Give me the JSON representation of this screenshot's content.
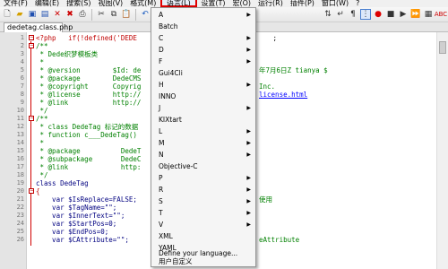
{
  "menubar": {
    "items": [
      "文件(F)",
      "编辑(E)",
      "搜索(S)",
      "视图(V)",
      "格式(M)",
      "语言(L)",
      "设置(T)",
      "宏(O)",
      "运行(R)",
      "插件(P)",
      "窗口(W)",
      "?"
    ]
  },
  "tab": {
    "label": "dedetag.class.php"
  },
  "toolbar_icons": [
    "new-file-icon",
    "open-icon",
    "save-icon",
    "save-all-icon",
    "close-icon",
    "close-all-icon",
    "print-icon",
    "cut-icon",
    "copy-icon",
    "paste-icon",
    "undo-icon",
    "redo-icon",
    "find-icon",
    "replace-icon",
    "zoom-in-icon",
    "zoom-out-icon",
    "sync-icon",
    "wrap-icon",
    "show-all-chars-icon",
    "indent-guide-icon",
    "record-macro-icon",
    "stop-record-icon",
    "play-macro-icon",
    "run-macro-multiple-icon",
    "save-macro-icon",
    "spellcheck-icon"
  ],
  "line_numbers": [
    "1",
    "2",
    "3",
    "4",
    "5",
    "6",
    "7",
    "8",
    "9",
    "10",
    "11",
    "12",
    "13",
    "14",
    "15",
    "16",
    "17",
    "18",
    "19",
    "20",
    "21",
    "22",
    "23",
    "24",
    "25",
    "26"
  ],
  "code": {
    "l1": "<?php   if(!defined('DEDE",
    "l1b": "   ;",
    "l2": "/**",
    "l3": " * Dede织梦模板类",
    "l4": " *",
    "l5": " * @version        $Id: de",
    "l5b": "年7月6日Z tianya $",
    "l6": " * @package        DedeCMS",
    "l7": " * @copyright      Copyrig",
    "l7b": "Inc.",
    "l8": " * @license        http://",
    "l8b": "license.html",
    "l9": " * @link           http://",
    "l10": " */",
    "l11": "/**",
    "l12": " * class DedeTag 标记的数据",
    "l13": " * function c___DedeTag()",
    "l14": " *",
    "l15": " * @package          DedeT",
    "l16": " * @subpackage       DedeC",
    "l17": " * @link             http:",
    "l18": " */",
    "l19": "class DedeTag",
    "l20": "{",
    "l21": "    var $IsReplace=FALSE;",
    "l21b": "使用",
    "l22": "    var $TagName=\"\";",
    "l23": "    var $InnerText=\"\";",
    "l24": "    var $StartPos=0;",
    "l25": "    var $EndPos=0;",
    "l26": "    var $CAttribute=\"\";",
    "l26b": "eAttribute"
  },
  "language_menu": {
    "items": [
      {
        "label": "A",
        "submenu": true
      },
      {
        "label": "Batch",
        "submenu": false
      },
      {
        "label": "C",
        "submenu": true
      },
      {
        "label": "D",
        "submenu": true
      },
      {
        "label": "F",
        "submenu": true
      },
      {
        "label": "Gui4Cli",
        "submenu": false
      },
      {
        "label": "H",
        "submenu": true
      },
      {
        "label": "INNO",
        "submenu": false
      },
      {
        "label": "J",
        "submenu": true
      },
      {
        "label": "KIXtart",
        "submenu": false
      },
      {
        "label": "L",
        "submenu": true
      },
      {
        "label": "M",
        "submenu": true
      },
      {
        "label": "N",
        "submenu": true
      },
      {
        "label": "Objective-C",
        "submenu": false
      },
      {
        "label": "P",
        "submenu": true
      },
      {
        "label": "R",
        "submenu": true
      },
      {
        "label": "S",
        "submenu": true
      },
      {
        "label": "T",
        "submenu": true
      },
      {
        "label": "V",
        "submenu": true
      },
      {
        "label": "XML",
        "submenu": false
      },
      {
        "label": "YAML",
        "submenu": false
      }
    ],
    "define_label": "Define your language...",
    "user_defined_label": "用户自定义"
  },
  "colors": {
    "highlight_border": "#e00000",
    "comment": "#008000",
    "keyword": "#0000ff"
  }
}
